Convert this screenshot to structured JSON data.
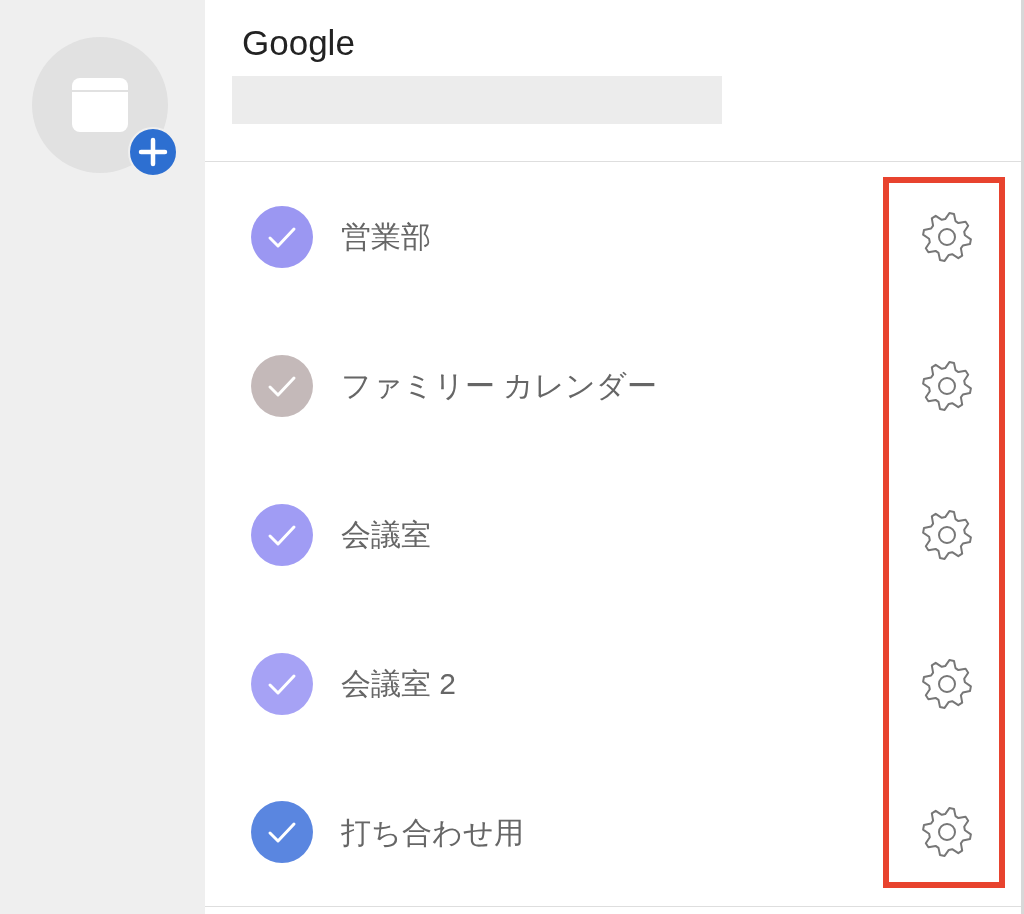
{
  "account": {
    "name": "Google",
    "detail_hidden": true
  },
  "calendars": [
    {
      "name": "営業部",
      "color": "#9b97f2",
      "checked": true
    },
    {
      "name": "ファミリー カレンダー",
      "color": "#c4b9b9",
      "checked": true
    },
    {
      "name": "会議室",
      "color": "#a09cf4",
      "checked": true
    },
    {
      "name": "会議室 2",
      "color": "#a6a2f5",
      "checked": true
    },
    {
      "name": "打ち合わせ用",
      "color": "#5a86e0",
      "checked": true
    }
  ],
  "highlight_settings": true
}
